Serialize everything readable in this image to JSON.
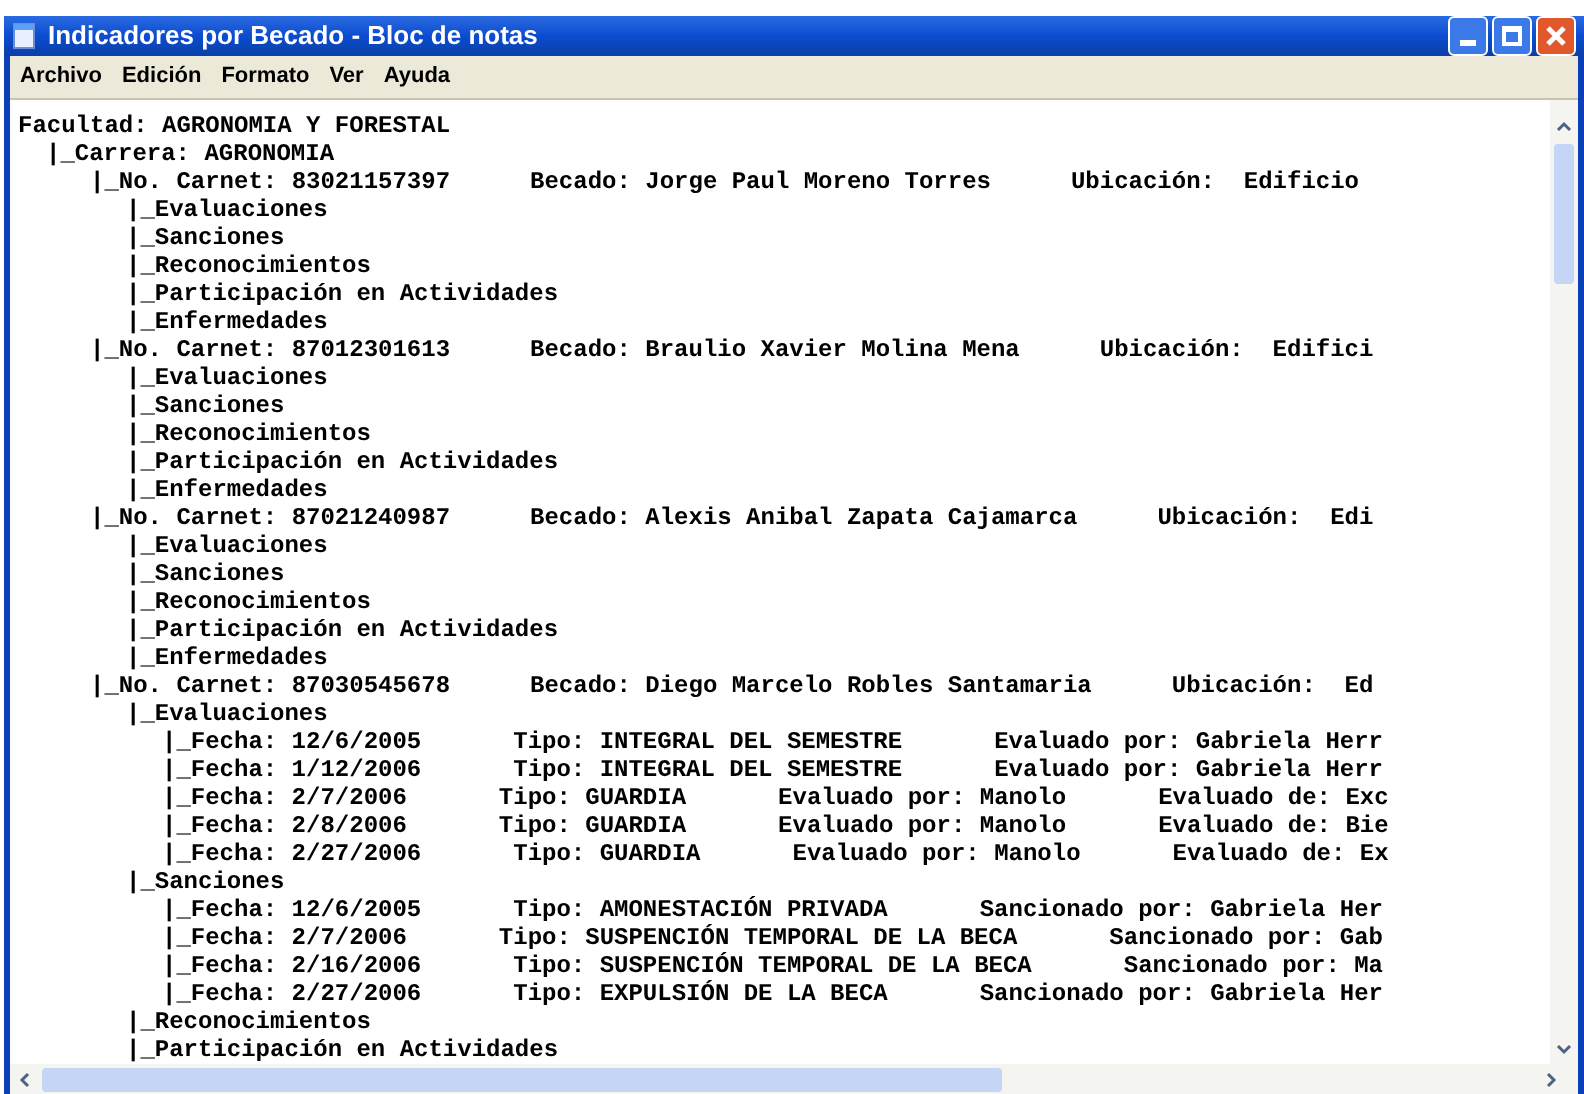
{
  "window": {
    "title": "Indicadores por Becado - Bloc de notas"
  },
  "menu": [
    "Archivo",
    "Edición",
    "Formato",
    "Ver",
    "Ayuda"
  ],
  "document": {
    "lines": [
      {
        "cells": [
          "Facultad: AGRONOMIA Y FORESTAL"
        ],
        "children": [
          {
            "cells": [
              "|_Carrera: AGRONOMIA"
            ],
            "children": [
              {
                "cells": [
                  "|_No. Carnet: 83021157397",
                  "Becado: Jorge Paul Moreno Torres",
                  "Ubicación:  Edificio"
                ],
                "children": [
                  {
                    "cells": [
                      "|_Evaluaciones"
                    ]
                  },
                  {
                    "cells": [
                      "|_Sanciones"
                    ]
                  },
                  {
                    "cells": [
                      "|_Reconocimientos"
                    ]
                  },
                  {
                    "cells": [
                      "|_Participación en Actividades"
                    ]
                  },
                  {
                    "cells": [
                      "|_Enfermedades"
                    ]
                  }
                ]
              },
              {
                "cells": [
                  "|_No. Carnet: 87012301613",
                  "Becado: Braulio Xavier Molina Mena",
                  "Ubicación:  Edifici"
                ],
                "children": [
                  {
                    "cells": [
                      "|_Evaluaciones"
                    ]
                  },
                  {
                    "cells": [
                      "|_Sanciones"
                    ]
                  },
                  {
                    "cells": [
                      "|_Reconocimientos"
                    ]
                  },
                  {
                    "cells": [
                      "|_Participación en Actividades"
                    ]
                  },
                  {
                    "cells": [
                      "|_Enfermedades"
                    ]
                  }
                ]
              },
              {
                "cells": [
                  "|_No. Carnet: 87021240987",
                  "Becado: Alexis Anibal Zapata Cajamarca",
                  "Ubicación:  Edi"
                ],
                "children": [
                  {
                    "cells": [
                      "|_Evaluaciones"
                    ]
                  },
                  {
                    "cells": [
                      "|_Sanciones"
                    ]
                  },
                  {
                    "cells": [
                      "|_Reconocimientos"
                    ]
                  },
                  {
                    "cells": [
                      "|_Participación en Actividades"
                    ]
                  },
                  {
                    "cells": [
                      "|_Enfermedades"
                    ]
                  }
                ]
              },
              {
                "cells": [
                  "|_No. Carnet: 87030545678",
                  "Becado: Diego Marcelo Robles Santamaria",
                  "Ubicación:  Ed"
                ],
                "children": [
                  {
                    "cells": [
                      "|_Evaluaciones"
                    ],
                    "children": [
                      {
                        "cells": [
                          "|_Fecha: 12/6/2005",
                          "Tipo: INTEGRAL DEL SEMESTRE",
                          "Evaluado por: Gabriela Herr"
                        ]
                      },
                      {
                        "cells": [
                          "|_Fecha: 1/12/2006",
                          "Tipo: INTEGRAL DEL SEMESTRE",
                          "Evaluado por: Gabriela Herr"
                        ]
                      },
                      {
                        "cells": [
                          "|_Fecha: 2/7/2006",
                          "Tipo: GUARDIA",
                          "Evaluado por: Manolo",
                          "Evaluado de: Exc"
                        ]
                      },
                      {
                        "cells": [
                          "|_Fecha: 2/8/2006",
                          "Tipo: GUARDIA",
                          "Evaluado por: Manolo",
                          "Evaluado de: Bie"
                        ]
                      },
                      {
                        "cells": [
                          "|_Fecha: 2/27/2006",
                          "Tipo: GUARDIA",
                          "Evaluado por: Manolo",
                          "Evaluado de: Ex"
                        ]
                      }
                    ]
                  },
                  {
                    "cells": [
                      "|_Sanciones"
                    ],
                    "children": [
                      {
                        "cells": [
                          "|_Fecha: 12/6/2005",
                          "Tipo: AMONESTACIÓN PRIVADA",
                          "Sancionado por: Gabriela Her"
                        ]
                      },
                      {
                        "cells": [
                          "|_Fecha: 2/7/2006",
                          "Tipo: SUSPENCIÓN TEMPORAL DE LA BECA",
                          "Sancionado por: Gab"
                        ]
                      },
                      {
                        "cells": [
                          "|_Fecha: 2/16/2006",
                          "Tipo: SUSPENCIÓN TEMPORAL DE LA BECA",
                          "Sancionado por: Ma"
                        ]
                      },
                      {
                        "cells": [
                          "|_Fecha: 2/27/2006",
                          "Tipo: EXPULSIÓN DE LA BECA",
                          "Sancionado por: Gabriela Her"
                        ]
                      }
                    ]
                  },
                  {
                    "cells": [
                      "|_Reconocimientos"
                    ]
                  },
                  {
                    "cells": [
                      "|_Participación en Actividades"
                    ]
                  }
                ]
              }
            ]
          }
        ]
      }
    ]
  }
}
